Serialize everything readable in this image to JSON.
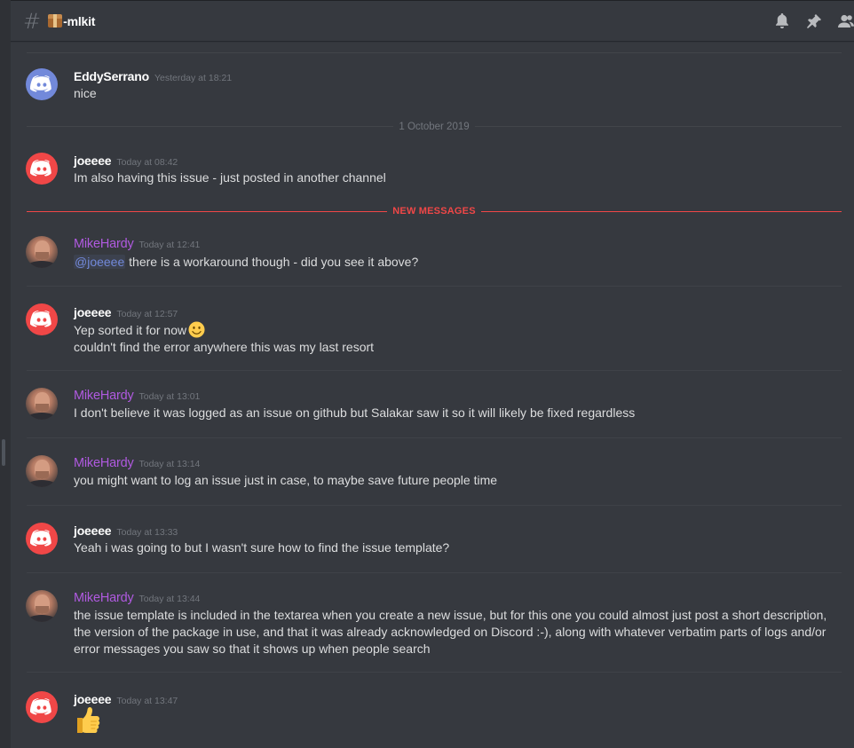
{
  "header": {
    "hash_symbol": "#",
    "channel_name": "-mlkit",
    "channel_icon": "package-icon",
    "icons": [
      "bell-icon",
      "pin-icon",
      "members-icon"
    ]
  },
  "dividers": {
    "date": "1 October 2019",
    "new_messages": "NEW MESSAGES"
  },
  "messages": [
    {
      "user": "EddySerrano",
      "time": "Yesterday at 18:21",
      "lines": [
        "nice"
      ],
      "avatar": "discord-blue"
    },
    {
      "user": "joeeee",
      "time": "Today at 08:42",
      "lines": [
        "Im also having this issue - just posted in another channel"
      ],
      "avatar": "discord-red"
    },
    {
      "user": "MikeHardy",
      "time": "Today at 12:41",
      "mention": "@joeeee",
      "lines": [
        " there is a workaround though - did you see it above?"
      ],
      "avatar": "photo"
    },
    {
      "user": "joeeee",
      "time": "Today at 12:57",
      "lines": [
        "Yep sorted it for now",
        "couldn't find the error anywhere this was my last resort"
      ],
      "avatar": "discord-red",
      "emoji": "slightly-smiling-face"
    },
    {
      "user": "MikeHardy",
      "time": "Today at 13:01",
      "lines": [
        "I don't believe it was logged as an issue on github but Salakar saw it so it will likely be fixed regardless"
      ],
      "avatar": "photo"
    },
    {
      "user": "MikeHardy",
      "time": "Today at 13:14",
      "lines": [
        "you might want to log an issue just in case, to maybe save future people time"
      ],
      "avatar": "photo"
    },
    {
      "user": "joeeee",
      "time": "Today at 13:33",
      "lines": [
        "Yeah i was going to but I wasn't sure how to find the issue template?"
      ],
      "avatar": "discord-red"
    },
    {
      "user": "MikeHardy",
      "time": "Today at 13:44",
      "lines": [
        "the issue template is included in the textarea when you create a new issue, but for this one you could almost just post a short description, the version of the package in use, and that it was already acknowledged on Discord :-), along with whatever verbatim parts of logs and/or error messages you saw so that it shows up when people search"
      ],
      "avatar": "photo"
    },
    {
      "user": "joeeee",
      "time": "Today at 13:47",
      "lines": [],
      "avatar": "discord-red",
      "emoji": "thumbs-up"
    }
  ],
  "colors": {
    "background": "#36393f",
    "username_default": "#ffffff",
    "username_mike": "#b05ae0",
    "new_messages_red": "#f04747",
    "mention": "#7289da"
  }
}
